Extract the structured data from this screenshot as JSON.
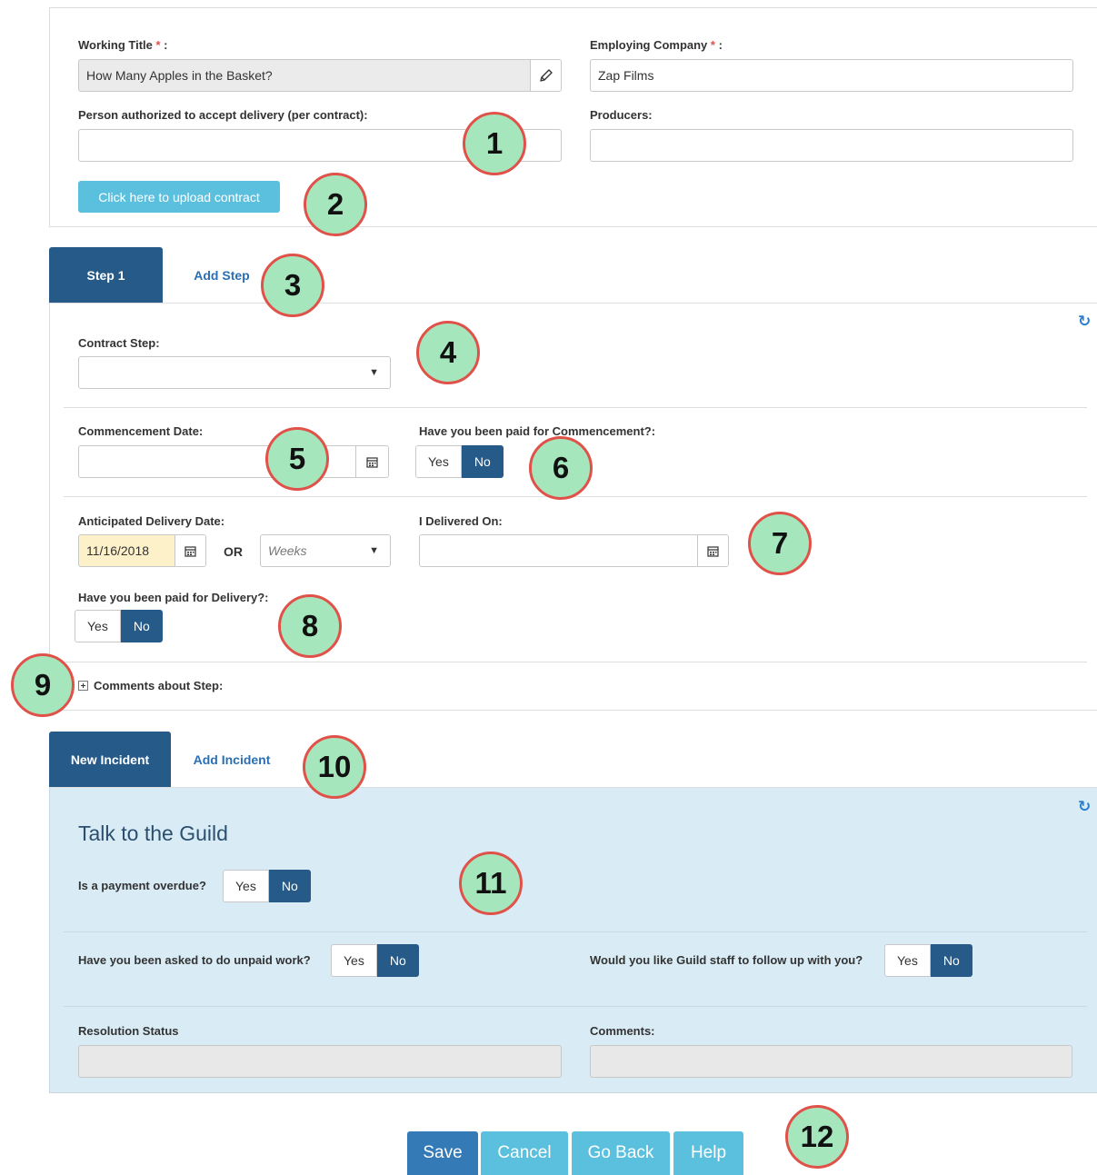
{
  "contract": {
    "working_title_label": "Working Title",
    "working_title_value": "How Many Apples in the Basket?",
    "employing_company_label": "Employing Company",
    "employing_company_value": "Zap Films",
    "required_mark": "*",
    "colon": ":",
    "person_label": "Person authorized to accept delivery (per contract):",
    "person_value": "",
    "producers_label": "Producers:",
    "producers_value": "",
    "upload_button": "Click here to upload contract"
  },
  "step_tabs": {
    "active": "Step 1",
    "add": "Add Step"
  },
  "step": {
    "contract_step_label": "Contract Step:",
    "contract_step_value": "",
    "commencement_date_label": "Commencement Date:",
    "commencement_date_value": "",
    "paid_commencement_label": "Have you been paid for Commencement?:",
    "paid_commencement": {
      "yes": "Yes",
      "no": "No",
      "selected": "No"
    },
    "anticipated_delivery_label": "Anticipated Delivery Date:",
    "anticipated_delivery_value": "11/16/2018",
    "or_label": "OR",
    "weeks_placeholder": "Weeks",
    "delivered_on_label": "I Delivered On:",
    "delivered_on_value": "",
    "paid_delivery_label": "Have you been paid for Delivery?:",
    "paid_delivery": {
      "yes": "Yes",
      "no": "No",
      "selected": "No"
    },
    "comments_label": "Comments about Step:",
    "comments_expand_icon": "plus-square-icon"
  },
  "incident_tabs": {
    "active": "New Incident",
    "add": "Add Incident"
  },
  "incident": {
    "heading": "Talk to the Guild",
    "payment_overdue_label": "Is a payment overdue?",
    "payment_overdue": {
      "yes": "Yes",
      "no": "No",
      "selected": "No"
    },
    "unpaid_work_label": "Have you been asked to do unpaid work?",
    "unpaid_work": {
      "yes": "Yes",
      "no": "No",
      "selected": "No"
    },
    "follow_up_label": "Would you like Guild staff to follow up with you?",
    "follow_up": {
      "yes": "Yes",
      "no": "No",
      "selected": "No"
    },
    "resolution_status_label": "Resolution Status",
    "resolution_status_value": "",
    "comments_label": "Comments:",
    "comments_value": ""
  },
  "actions": {
    "save": "Save",
    "cancel": "Cancel",
    "go_back": "Go Back",
    "help": "Help"
  },
  "callouts": [
    "1",
    "2",
    "3",
    "4",
    "5",
    "6",
    "7",
    "8",
    "9",
    "10",
    "11",
    "12"
  ],
  "colors": {
    "primary": "#265a88",
    "info_button": "#5bc0de",
    "link": "#2a6fb5",
    "incident_bg": "#d9ecf6",
    "callout_fill": "#a6e6bd",
    "callout_border": "#e05249",
    "required": "#d9534f"
  }
}
